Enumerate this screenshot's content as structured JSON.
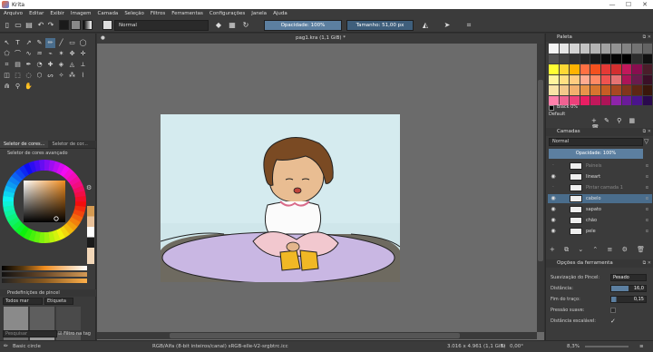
{
  "window": {
    "title": "Krita",
    "controls": [
      "—",
      "☐",
      "✕"
    ]
  },
  "menu": [
    "Arquivo",
    "Editar",
    "Exibir",
    "Imagem",
    "Camada",
    "Seleção",
    "Filtros",
    "Ferramentas",
    "Configurações",
    "Janela",
    "Ajuda"
  ],
  "toolbar": {
    "blend_mode": "Normal",
    "opacity": "Opacidade: 100%",
    "size": "Tamanho: 51,00 px",
    "fg_color": "#1a1a1a",
    "bg_color": "#ffffff"
  },
  "document": {
    "tab_title": "pag1.kra (1,1 GiB) *"
  },
  "left_panel": {
    "tabs": [
      "Seletor de cores...",
      "Seletor de cor..."
    ],
    "color_selector_title": "Seletor de cores avançado",
    "brush_presets_title": "Predefinições de pincel",
    "brush_filter": "Todos mar",
    "brush_tag": "Etiqueta",
    "search_placeholder": "Pesquisar",
    "filter_checkbox": "Filtro na tag"
  },
  "palette": {
    "title": "Paleta",
    "selected_color": "Black 0%",
    "palette_name": "Default",
    "colors": [
      "#f5f5f5",
      "#e6e6e6",
      "#d4d4d4",
      "#c4c4c4",
      "#b4b4b4",
      "#a3a3a3",
      "#939393",
      "#838383",
      "#737373",
      "#636363",
      "#535353",
      "#434343",
      "#333333",
      "#262626",
      "#1a1a1a",
      "#0d0d0d",
      "#050505",
      "#000000",
      "#2d2d2d",
      "#111111",
      "#ffff33",
      "#fdd835",
      "#ffb300",
      "#ff7043",
      "#f4511e",
      "#e53935",
      "#d32f2f",
      "#c2185b",
      "#880e4f",
      "#4a1d2a",
      "#fff59d",
      "#ffe082",
      "#ffcc80",
      "#ffab91",
      "#ff8a65",
      "#ef5350",
      "#e57373",
      "#ad1457",
      "#6a1b4d",
      "#3b1027",
      "#f9e4a6",
      "#f3c98b",
      "#f2b06e",
      "#e8944a",
      "#d8752f",
      "#c75d24",
      "#a84822",
      "#82351c",
      "#5e2614",
      "#3a170c",
      "#ff80ab",
      "#f06292",
      "#ec407a",
      "#e91e63",
      "#c2185b",
      "#ad1457",
      "#8e24aa",
      "#6a1b9a",
      "#4a148c",
      "#2a0a4d"
    ]
  },
  "layers": {
    "title": "Camadas",
    "blend_mode": "Normal",
    "opacity": "Opacidade: 100%",
    "items": [
      {
        "name": "Paineis",
        "flags": "α",
        "dim": true,
        "selected": false
      },
      {
        "name": "lineart",
        "flags": "α",
        "dim": false,
        "selected": false
      },
      {
        "name": "Pintar camada 1",
        "flags": "α",
        "dim": true,
        "selected": false
      },
      {
        "name": "cabelo",
        "flags": "α",
        "dim": false,
        "selected": true
      },
      {
        "name": "sapato",
        "flags": "α",
        "dim": false,
        "selected": false
      },
      {
        "name": "chão",
        "flags": "α",
        "dim": false,
        "selected": false
      },
      {
        "name": "pele",
        "flags": "α",
        "dim": false,
        "selected": false
      }
    ]
  },
  "tool_options": {
    "title": "Opções da ferramenta",
    "smoothing_label": "Suavização do Pincel:",
    "smoothing_value": "Pesado",
    "distance_label": "Distância:",
    "distance_value": "16,0",
    "stroke_end_label": "Fim do traço:",
    "stroke_end_value": "0,15",
    "smooth_pressure_label": "Pressão suave:",
    "scalable_distance_label": "Distância escalável:"
  },
  "status": {
    "brush": "Basic circle",
    "color_space": "RGB/Alfa (8-bit inteiros/canal)  sRGB-elle-V2-srgbtrc.icc",
    "dimensions": "3.016 x 4.961 (1,1 GiB)",
    "rotation": "0,00°",
    "zoom": "8,3%"
  }
}
